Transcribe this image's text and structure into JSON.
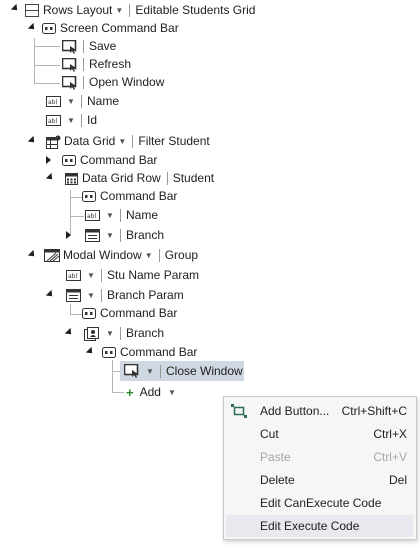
{
  "tree": {
    "root": {
      "label": "Rows Layout",
      "caption": "Editable Students Grid"
    },
    "screen_command_bar": {
      "label": "Screen Command Bar"
    },
    "save": {
      "label": "Save"
    },
    "refresh": {
      "label": "Refresh"
    },
    "open_window": {
      "label": "Open Window"
    },
    "name_field": {
      "label": "Name"
    },
    "id_field": {
      "label": "Id"
    },
    "data_grid": {
      "label": "Data Grid",
      "caption": "Filter Student"
    },
    "dg_command_bar": {
      "label": "Command Bar"
    },
    "data_grid_row": {
      "label": "Data Grid Row",
      "caption": "Student"
    },
    "row_command_bar": {
      "label": "Command Bar"
    },
    "row_name": {
      "label": "Name"
    },
    "row_branch": {
      "label": "Branch"
    },
    "modal_window": {
      "label": "Modal Window",
      "caption": "Group"
    },
    "stu_name_param": {
      "label": "Stu Name Param"
    },
    "branch_param": {
      "label": "Branch Param"
    },
    "bp_command_bar": {
      "label": "Command Bar"
    },
    "branch": {
      "label": "Branch"
    },
    "branch_command_bar": {
      "label": "Command Bar"
    },
    "close_window": {
      "label": "Close Window"
    },
    "add": {
      "label": "Add"
    }
  },
  "context_menu": {
    "items": [
      {
        "label": "Add Button...",
        "shortcut": "Ctrl+Shift+C",
        "enabled": true,
        "icon": "add-button-icon"
      },
      {
        "label": "Cut",
        "shortcut": "Ctrl+X",
        "enabled": true
      },
      {
        "label": "Paste",
        "shortcut": "Ctrl+V",
        "enabled": false
      },
      {
        "label": "Delete",
        "shortcut": "Del",
        "enabled": true
      },
      {
        "label": "Edit CanExecute Code",
        "shortcut": "",
        "enabled": true
      },
      {
        "label": "Edit Execute Code",
        "shortcut": "",
        "enabled": true
      }
    ]
  },
  "colors": {
    "selection": "#cfd7e2",
    "menu_bg": "#f6f6f6",
    "disabled_text": "#a6a6a6",
    "add_plus": "#2c8a2c"
  }
}
